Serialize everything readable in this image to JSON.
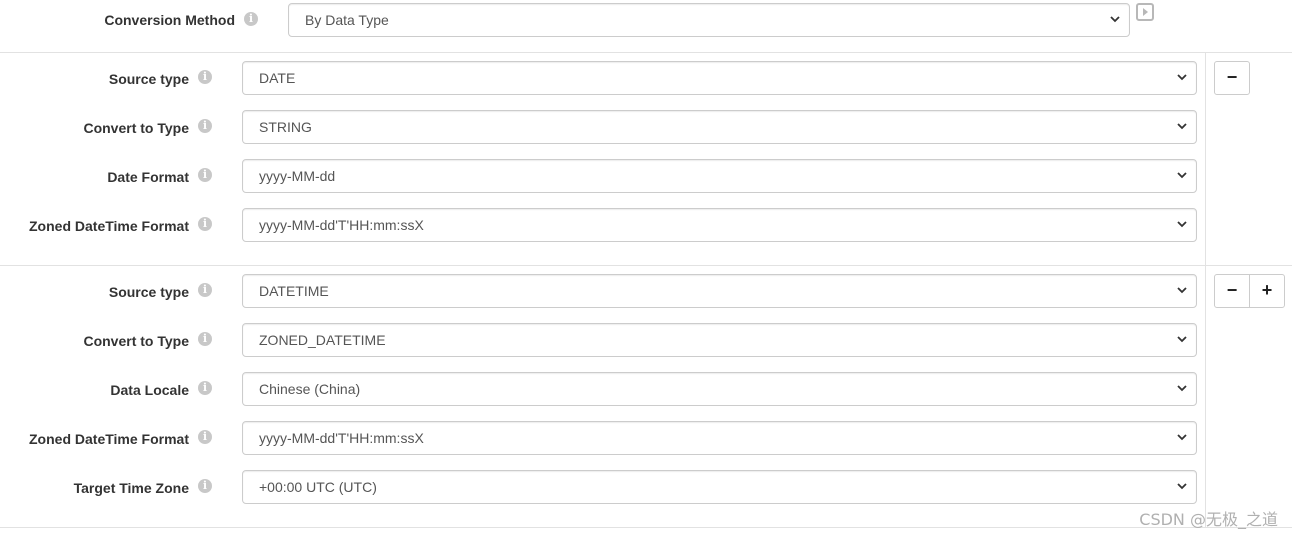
{
  "header": {
    "conversion_method_label": "Conversion Method",
    "conversion_method_value": "By Data Type",
    "run_icon": "play-square-icon"
  },
  "group1": {
    "source_type_label": "Source type",
    "source_type_value": "DATE",
    "convert_to_label": "Convert to Type",
    "convert_to_value": "STRING",
    "date_format_label": "Date Format",
    "date_format_value": "yyyy-MM-dd",
    "zoned_format_label": "Zoned DateTime Format",
    "zoned_format_value": "yyyy-MM-dd'T'HH:mm:ssX",
    "remove_label": "−"
  },
  "group2": {
    "source_type_label": "Source type",
    "source_type_value": "DATETIME",
    "convert_to_label": "Convert to Type",
    "convert_to_value": "ZONED_DATETIME",
    "locale_label": "Data Locale",
    "locale_value": "Chinese (China)",
    "zoned_format_label": "Zoned DateTime Format",
    "zoned_format_value": "yyyy-MM-dd'T'HH:mm:ssX",
    "timezone_label": "Target Time Zone",
    "timezone_value": "+00:00 UTC (UTC)",
    "remove_label": "−",
    "add_label": "+"
  },
  "info_icon_glyph": "i",
  "watermark": "CSDN @无极_之道"
}
